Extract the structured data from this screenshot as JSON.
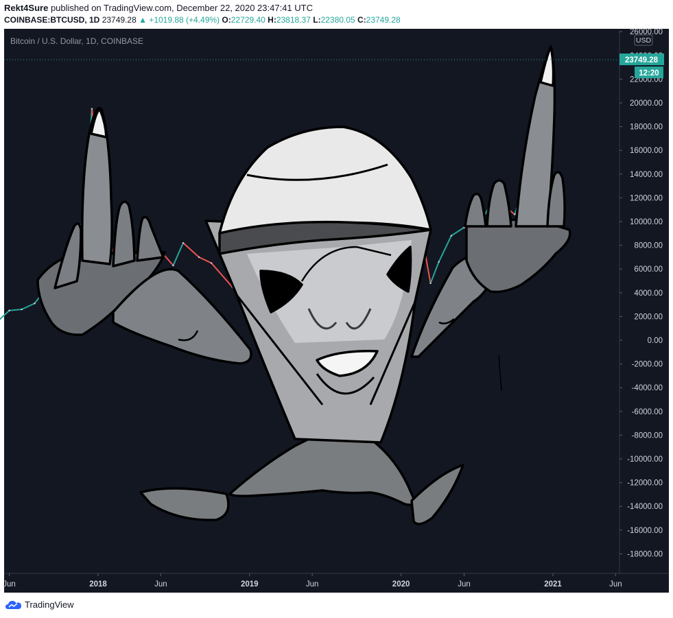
{
  "header": {
    "author": "Rekt4Sure",
    "published": "published on TradingView.com, December 22, 2020 23:47:41 UTC",
    "symbol": "COINBASE:BTCUSD, 1D",
    "last": "23749.28",
    "change": "▲ +1019.88 (+4.49%)",
    "o_label": "O:",
    "o_value": "22729.40",
    "h_label": "H:",
    "h_value": "23818.37",
    "l_label": "L:",
    "l_value": "22380.05",
    "c_label": "C:",
    "c_value": "23749.28"
  },
  "legend": {
    "title": "Bitcoin / U.S. Dollar, 1D, COINBASE"
  },
  "price_axis": {
    "currency": "USD",
    "last_price_tag": "23749.28",
    "countdown_tag": "12:20"
  },
  "footer": {
    "brand": "TradingView"
  },
  "colors": {
    "background": "#131722",
    "up": "#26a69a",
    "down": "#ef5350",
    "axis_text": "#d1d4dc",
    "brand": "#2962ff"
  },
  "chart_data": {
    "type": "line",
    "title": "Bitcoin / U.S. Dollar, 1D, COINBASE",
    "xlabel": "",
    "ylabel": "",
    "ylim": [
      -19000,
      26500
    ],
    "y_ticks": [
      26000,
      24000,
      22000,
      20000,
      18000,
      16000,
      14000,
      12000,
      10000,
      8000,
      6000,
      4000,
      2000,
      0,
      -2000,
      -4000,
      -6000,
      -8000,
      -10000,
      -12000,
      -14000,
      -16000,
      -18000
    ],
    "y_tick_labels": [
      "26000.00",
      "24000.00",
      "22000.00",
      "20000.00",
      "18000.00",
      "16000.00",
      "14000.00",
      "12000.00",
      "10000.00",
      "8000.00",
      "6000.00",
      "4000.00",
      "2000.00",
      "0.00",
      "-2000.00",
      "-4000.00",
      "-6000.00",
      "-8000.00",
      "-10000.00",
      "-12000.00",
      "-14000.00",
      "-16000.00",
      "-18000.00"
    ],
    "x_ticks": [
      {
        "label": "Jun",
        "date": "2017-06-01"
      },
      {
        "label": "2018",
        "date": "2018-01-01"
      },
      {
        "label": "Jun",
        "date": "2018-06-01"
      },
      {
        "label": "2019",
        "date": "2019-01-01"
      },
      {
        "label": "Jun",
        "date": "2019-06-01"
      },
      {
        "label": "2020",
        "date": "2020-01-01"
      },
      {
        "label": "Jun",
        "date": "2020-06-01"
      },
      {
        "label": "2021",
        "date": "2021-01-01"
      },
      {
        "label": "Jun",
        "date": "2021-06-01"
      }
    ],
    "series": [
      {
        "name": "BTCUSD",
        "points": [
          [
            "2017-04-01",
            1100
          ],
          [
            "2017-05-01",
            1500
          ],
          [
            "2017-06-01",
            2500
          ],
          [
            "2017-07-01",
            2600
          ],
          [
            "2017-08-01",
            3100
          ],
          [
            "2017-09-01",
            4500
          ],
          [
            "2017-10-01",
            4900
          ],
          [
            "2017-11-01",
            7000
          ],
          [
            "2017-12-01",
            11000
          ],
          [
            "2017-12-17",
            19500
          ],
          [
            "2018-01-01",
            14000
          ],
          [
            "2018-01-15",
            13500
          ],
          [
            "2018-02-06",
            7000
          ],
          [
            "2018-03-01",
            10500
          ],
          [
            "2018-04-01",
            7000
          ],
          [
            "2018-05-01",
            9000
          ],
          [
            "2018-06-01",
            7500
          ],
          [
            "2018-07-01",
            6300
          ],
          [
            "2018-07-25",
            8200
          ],
          [
            "2018-09-01",
            7000
          ],
          [
            "2018-10-01",
            6500
          ],
          [
            "2018-11-20",
            4500
          ],
          [
            "2018-12-15",
            3300
          ],
          [
            "2019-01-01",
            3700
          ],
          [
            "2019-02-01",
            3500
          ],
          [
            "2019-03-01",
            3800
          ],
          [
            "2019-04-01",
            4100
          ],
          [
            "2019-05-01",
            5400
          ],
          [
            "2019-06-01",
            8500
          ],
          [
            "2019-06-26",
            12900
          ],
          [
            "2019-07-15",
            10500
          ],
          [
            "2019-08-01",
            10000
          ],
          [
            "2019-09-01",
            9800
          ],
          [
            "2019-10-01",
            8300
          ],
          [
            "2019-10-26",
            9500
          ],
          [
            "2019-11-25",
            7100
          ],
          [
            "2020-01-01",
            7200
          ],
          [
            "2020-02-13",
            10300
          ],
          [
            "2020-03-12",
            4800
          ],
          [
            "2020-04-01",
            6600
          ],
          [
            "2020-05-01",
            8800
          ],
          [
            "2020-06-01",
            9500
          ],
          [
            "2020-07-01",
            9200
          ],
          [
            "2020-08-01",
            11300
          ],
          [
            "2020-09-01",
            11900
          ],
          [
            "2020-09-20",
            10900
          ],
          [
            "2020-10-01",
            10600
          ],
          [
            "2020-10-21",
            12800
          ],
          [
            "2020-11-01",
            13800
          ],
          [
            "2020-11-15",
            16000
          ],
          [
            "2020-12-01",
            19200
          ],
          [
            "2020-12-15",
            19400
          ],
          [
            "2020-12-22",
            23749.28
          ]
        ]
      }
    ],
    "last_price": 23749.28,
    "grid": false
  }
}
